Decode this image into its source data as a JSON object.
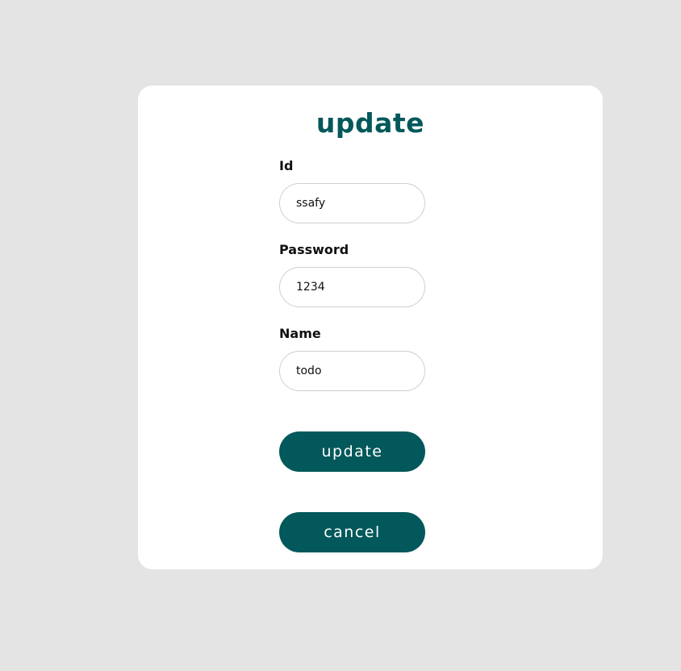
{
  "form": {
    "title": "update",
    "fields": [
      {
        "label": "Id",
        "value": "ssafy"
      },
      {
        "label": "Password",
        "value": "1234"
      },
      {
        "label": "Name",
        "value": "todo"
      }
    ],
    "submit_label": "update",
    "cancel_label": "cancel"
  },
  "colors": {
    "accent": "#02585a",
    "page_background": "#e4e4e4",
    "card_background": "#ffffff",
    "input_border": "#cfcfcf"
  }
}
